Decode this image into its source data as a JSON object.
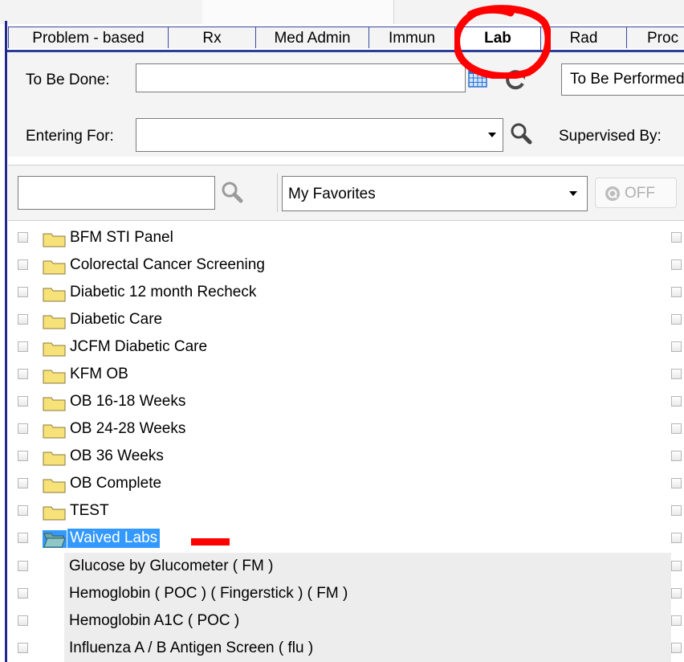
{
  "tabs": [
    {
      "label": "Problem - based",
      "active": false
    },
    {
      "label": "Rx",
      "active": false
    },
    {
      "label": "Med Admin",
      "active": false
    },
    {
      "label": "Immun",
      "active": false
    },
    {
      "label": "Lab",
      "active": true
    },
    {
      "label": "Rad",
      "active": false
    },
    {
      "label": "Proc",
      "active": false
    }
  ],
  "form": {
    "to_be_done_label": "To Be Done:",
    "to_be_done_value": "",
    "to_be_performed_value": "To Be Performed",
    "entering_for_label": "Entering For:",
    "entering_for_value": "",
    "supervised_by_label": "Supervised By:"
  },
  "filter": {
    "search_value": "",
    "favorites_value": "My Favorites",
    "toggle_label": "OFF"
  },
  "list": {
    "folders": [
      {
        "label": "BFM STI Panel",
        "open": false,
        "selected": false
      },
      {
        "label": "Colorectal Cancer Screening",
        "open": false,
        "selected": false
      },
      {
        "label": "Diabetic 12 month Recheck",
        "open": false,
        "selected": false
      },
      {
        "label": "Diabetic Care",
        "open": false,
        "selected": false
      },
      {
        "label": "JCFM Diabetic Care",
        "open": false,
        "selected": false
      },
      {
        "label": "KFM OB",
        "open": false,
        "selected": false
      },
      {
        "label": "OB 16-18 Weeks",
        "open": false,
        "selected": false
      },
      {
        "label": "OB 24-28 Weeks",
        "open": false,
        "selected": false
      },
      {
        "label": "OB 36 Weeks",
        "open": false,
        "selected": false
      },
      {
        "label": "OB Complete",
        "open": false,
        "selected": false
      },
      {
        "label": "TEST",
        "open": false,
        "selected": false
      },
      {
        "label": "Waived Labs",
        "open": true,
        "selected": true
      }
    ],
    "subitems": [
      {
        "label": "Glucose by Glucometer ( FM )"
      },
      {
        "label": "Hemoglobin ( POC ) ( Fingerstick ) ( FM )"
      },
      {
        "label": "Hemoglobin A1C ( POC )"
      },
      {
        "label": "Influenza A / B Antigen Screen ( flu )"
      }
    ]
  },
  "colors": {
    "tab_border": "#3a4a9e",
    "selection": "#3399ff",
    "folder_fill": "#f7e27a",
    "annotation": "#ff0000"
  },
  "icons": [
    "calendar-icon",
    "refresh-icon",
    "search-icon",
    "dropdown-arrow-icon",
    "folder-icon",
    "open-folder-icon",
    "toggle-icon"
  ]
}
